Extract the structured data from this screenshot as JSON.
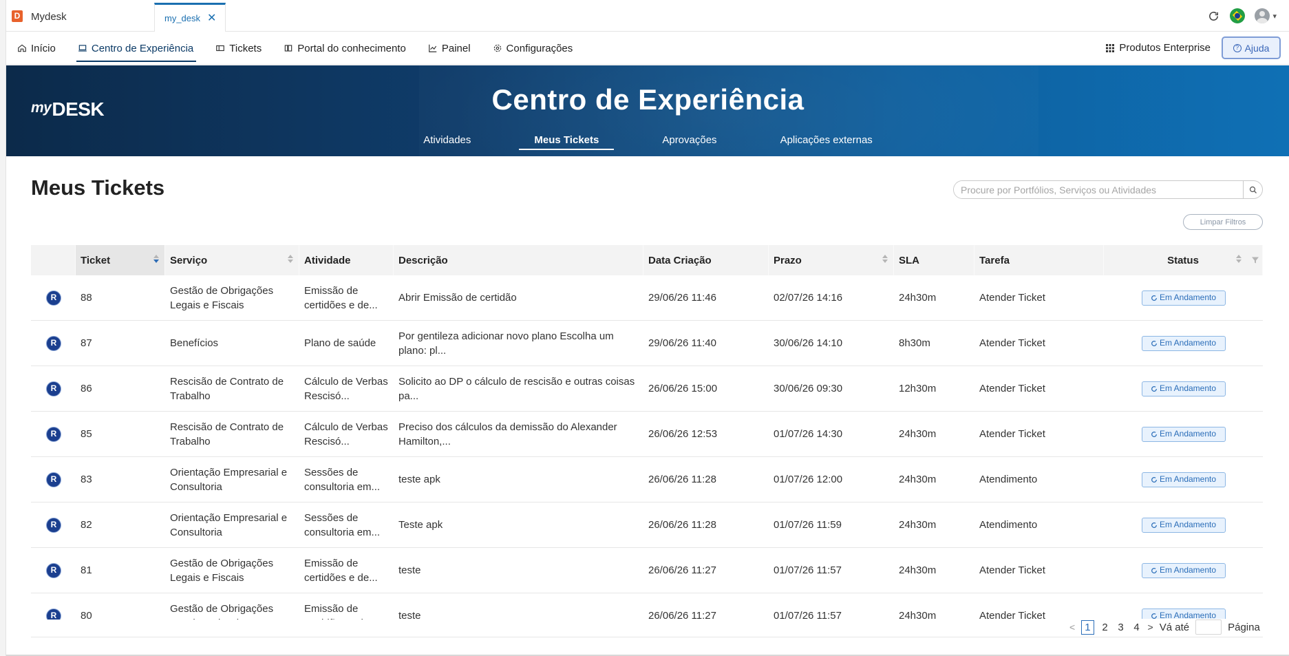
{
  "titlebar": {
    "app_name": "Mydesk",
    "app_logo_letter": "D",
    "active_tab": "my_desk",
    "close_glyph": "✕",
    "icons": [
      "refresh-icon",
      "brazil-flag-icon",
      "avatar",
      "chevron-down-icon"
    ]
  },
  "nav": {
    "items": [
      {
        "label": "Início",
        "icon": "home-icon"
      },
      {
        "label": "Centro de Experiência",
        "icon": "laptop-icon"
      },
      {
        "label": "Tickets",
        "icon": "ticket-icon"
      },
      {
        "label": "Portal do conhecimento",
        "icon": "book-icon"
      },
      {
        "label": "Painel",
        "icon": "chart-icon"
      },
      {
        "label": "Configurações",
        "icon": "gear-icon"
      }
    ],
    "active": "Centro de Experiência",
    "enterprise_label": "Produtos Enterprise",
    "help_label": "Ajuda",
    "accent_color": "#0b3a66"
  },
  "banner": {
    "logo_my": "my",
    "logo_desk": "DESK",
    "title": "Centro de Experiência",
    "subtabs": [
      "Atividades",
      "Meus Tickets",
      "Aprovações",
      "Aplicações externas"
    ],
    "active_subtab": "Meus Tickets"
  },
  "page": {
    "title": "Meus Tickets",
    "search_placeholder": "Procure por Portfólios, Serviços ou Atividades",
    "clear_filters": "Limpar Filtros"
  },
  "table": {
    "headers": [
      "",
      "Ticket",
      "Serviço",
      "Atividade",
      "Descrição",
      "Data Criação",
      "Prazo",
      "SLA",
      "Tarefa",
      "Status"
    ],
    "rows": [
      {
        "badge": "R",
        "ticket": "88",
        "servico": "Gestão de Obrigações Legais e Fiscais",
        "atividade": "Emissão de certidões e de...",
        "descricao": "Abrir Emissão de certidão",
        "criacao": "29/06/26 11:46",
        "prazo": "02/07/26 14:16",
        "sla": "24h30m",
        "tarefa": "Atender Ticket",
        "status": "Em Andamento"
      },
      {
        "badge": "R",
        "ticket": "87",
        "servico": "Benefícios",
        "atividade": "Plano de saúde",
        "descricao": "Por gentileza adicionar novo plano Escolha um plano: pl...",
        "criacao": "29/06/26 11:40",
        "prazo": "30/06/26 14:10",
        "sla": "8h30m",
        "tarefa": "Atender Ticket",
        "status": "Em Andamento"
      },
      {
        "badge": "R",
        "ticket": "86",
        "servico": "Rescisão de Contrato de Trabalho",
        "atividade": "Cálculo de Verbas Rescisó...",
        "descricao": "Solicito ao DP o cálculo de rescisão e outras coisas pa...",
        "criacao": "26/06/26 15:00",
        "prazo": "30/06/26 09:30",
        "sla": "12h30m",
        "tarefa": "Atender Ticket",
        "status": "Em Andamento"
      },
      {
        "badge": "R",
        "ticket": "85",
        "servico": "Rescisão de Contrato de Trabalho",
        "atividade": "Cálculo de Verbas Rescisó...",
        "descricao": "Preciso dos cálculos da demissão do Alexander Hamilton,...",
        "criacao": "26/06/26 12:53",
        "prazo": "01/07/26 14:30",
        "sla": "24h30m",
        "tarefa": "Atender Ticket",
        "status": "Em Andamento"
      },
      {
        "badge": "R",
        "ticket": "83",
        "servico": "Orientação Empresarial e Consultoria",
        "atividade": "Sessões de consultoria em...",
        "descricao": "teste apk",
        "criacao": "26/06/26 11:28",
        "prazo": "01/07/26 12:00",
        "sla": "24h30m",
        "tarefa": "Atendimento",
        "status": "Em Andamento"
      },
      {
        "badge": "R",
        "ticket": "82",
        "servico": "Orientação Empresarial e Consultoria",
        "atividade": "Sessões de consultoria em...",
        "descricao": "Teste apk",
        "criacao": "26/06/26 11:28",
        "prazo": "01/07/26 11:59",
        "sla": "24h30m",
        "tarefa": "Atendimento",
        "status": "Em Andamento"
      },
      {
        "badge": "R",
        "ticket": "81",
        "servico": "Gestão de Obrigações Legais e Fiscais",
        "atividade": "Emissão de certidões e de...",
        "descricao": "teste",
        "criacao": "26/06/26 11:27",
        "prazo": "01/07/26 11:57",
        "sla": "24h30m",
        "tarefa": "Atender Ticket",
        "status": "Em Andamento"
      },
      {
        "badge": "R",
        "ticket": "80",
        "servico": "Gestão de Obrigações Legais e Fiscais",
        "atividade": "Emissão de certidões e de...",
        "descricao": "teste",
        "criacao": "26/06/26 11:27",
        "prazo": "01/07/26 11:57",
        "sla": "24h30m",
        "tarefa": "Atender Ticket",
        "status": "Em Andamento"
      }
    ]
  },
  "pagination": {
    "prev": "<",
    "pages": [
      "1",
      "2",
      "3",
      "4"
    ],
    "current": "1",
    "next": ">",
    "goto_label": "Vá até",
    "page_label": "Página"
  },
  "colors": {
    "status_border": "#8cb6e4",
    "status_bg": "#e8f2fd",
    "status_text": "#2a6db8",
    "badge_bg": "#1b3f8f"
  }
}
